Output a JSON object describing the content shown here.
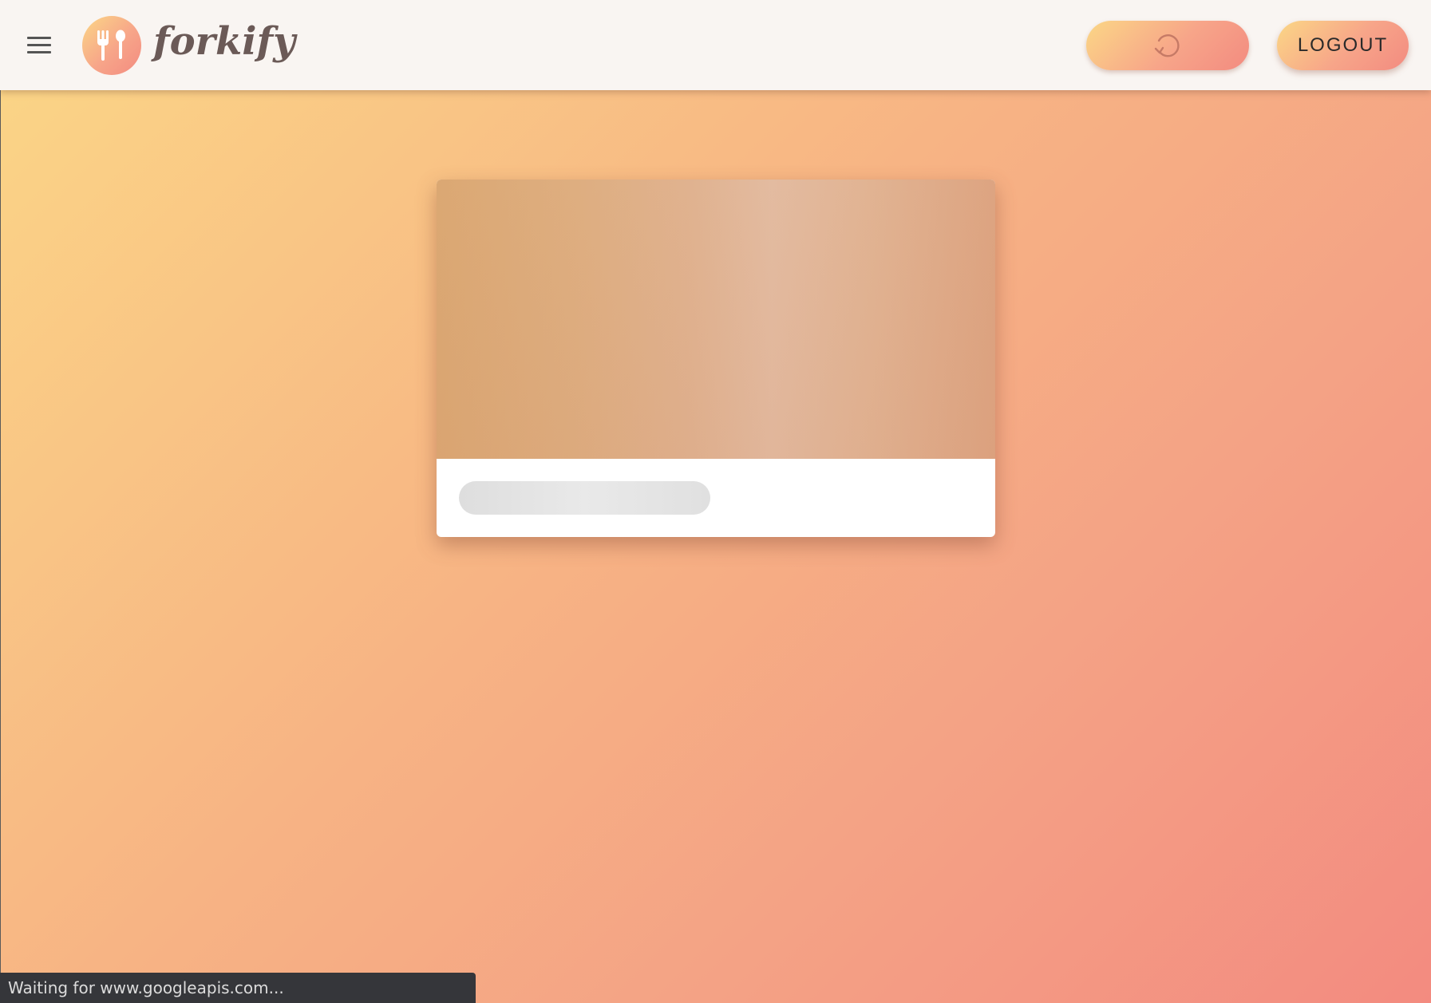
{
  "header": {
    "brand": "forkify",
    "logout_label": "LOGOUT"
  },
  "icons": {
    "menu": "hamburger-menu-icon",
    "logo": "fork-spoon-icon",
    "refresh": "refresh-icon"
  },
  "status_bar": {
    "text": "Waiting for www.googleapis.com..."
  },
  "colors": {
    "gradient_start": "#fbd786",
    "gradient_end": "#f38b80",
    "header_bg": "#f9f5f2",
    "brand_text": "#6b5a57",
    "status_bg": "#35363a"
  }
}
